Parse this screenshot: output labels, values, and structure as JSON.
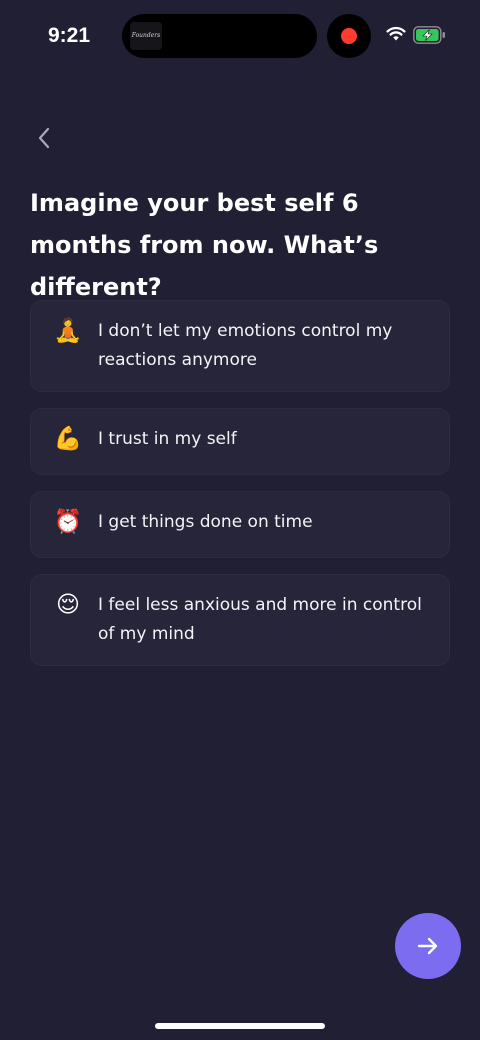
{
  "status_bar": {
    "time": "9:21",
    "island_thumbnail_text": "Founders",
    "record_color": "#ff3b30",
    "battery_color": "#34c759",
    "icons": [
      "wifi-icon",
      "battery-charging-icon",
      "record-indicator-icon"
    ]
  },
  "navigation": {
    "back_icon": "chevron-left-icon"
  },
  "question": {
    "title": "Imagine your best self 6 months from now. What’s different?"
  },
  "options": [
    {
      "emoji": "🧘",
      "icon": "meditation-icon",
      "label": "I don’t let my emotions control my reactions anymore"
    },
    {
      "emoji": "💪",
      "icon": "flexed-biceps-icon",
      "label": "I trust in my self"
    },
    {
      "emoji": "⏰",
      "icon": "alarm-clock-icon",
      "label": "I get things done on time"
    },
    {
      "emoji": "😌",
      "icon": "relieved-face-icon",
      "label": "I feel less anxious and more in control of my mind"
    }
  ],
  "next_button": {
    "icon": "arrow-right-icon",
    "color": "#7b6cf0"
  },
  "theme": {
    "background": "#211f33",
    "card_background": "#26253a"
  }
}
